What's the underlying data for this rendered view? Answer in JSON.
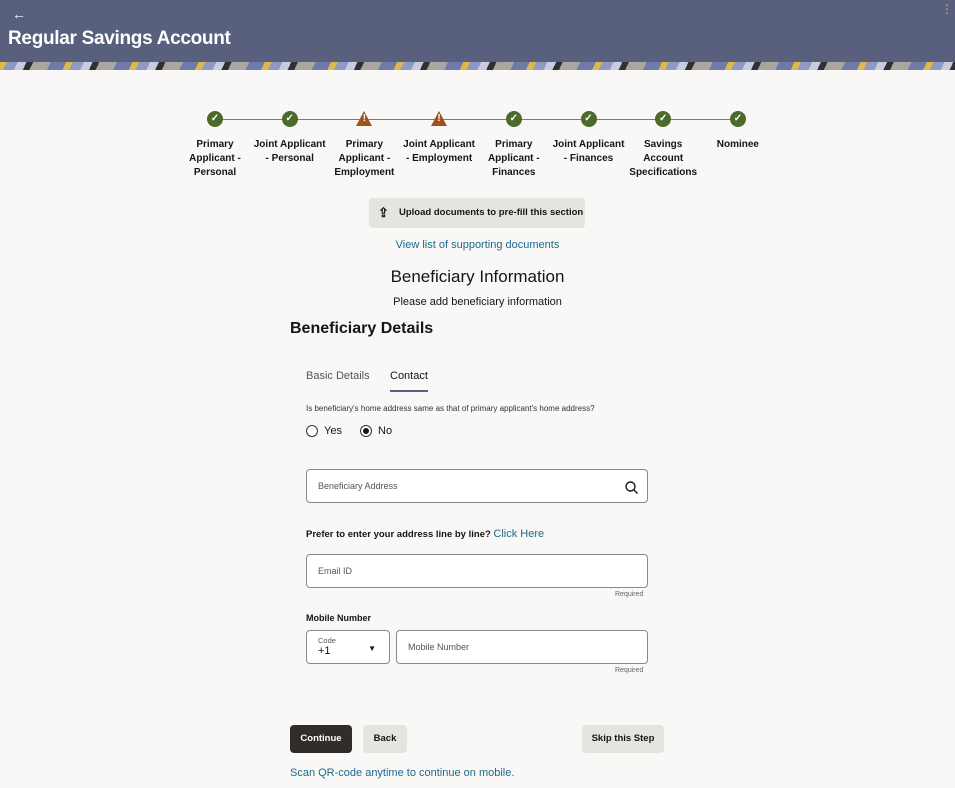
{
  "header": {
    "back_icon": "←",
    "title": "Regular Savings Account",
    "menu_icon": "⋮"
  },
  "steps": [
    {
      "label": "Primary Applicant - Personal",
      "status": "complete"
    },
    {
      "label": "Joint Applicant - Personal",
      "status": "complete"
    },
    {
      "label": "Primary Applicant - Employment",
      "status": "warning"
    },
    {
      "label": "Joint Applicant - Employment",
      "status": "warning"
    },
    {
      "label": "Primary Applicant - Finances",
      "status": "complete"
    },
    {
      "label": "Joint Applicant - Finances",
      "status": "complete"
    },
    {
      "label": "Savings Account Specifications",
      "status": "complete"
    },
    {
      "label": "Nominee",
      "status": "complete"
    }
  ],
  "upload_label": "Upload documents to pre-fill this section",
  "supporting_link": "View list of supporting documents",
  "section_title": "Beneficiary Information",
  "section_subtitle": "Please add beneficiary information",
  "details_heading": "Beneficiary Details",
  "tabs": [
    {
      "label": "Basic Details",
      "active": false
    },
    {
      "label": "Contact",
      "active": true
    }
  ],
  "question": "Is beneficiary's home address same as that of primary applicant's home address?",
  "radios": {
    "yes": "Yes",
    "no": "No",
    "selected": "No"
  },
  "address_placeholder": "Beneficiary Address",
  "line_by_line_prompt": "Prefer to enter your address line by line?",
  "click_here": "Click Here",
  "email_placeholder": "Email ID",
  "required": "Required",
  "mobile_label": "Mobile Number",
  "code_label": "Code",
  "code_value": "+1",
  "mobile_placeholder": "Mobile Number",
  "buttons": {
    "continue": "Continue",
    "back": "Back",
    "skip": "Skip this Step"
  },
  "qr_link": "Scan QR-code anytime to continue on mobile."
}
